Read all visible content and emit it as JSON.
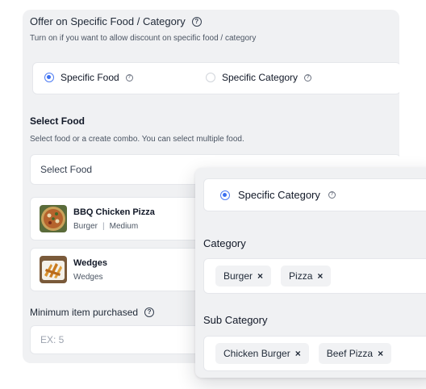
{
  "offer": {
    "title": "Offer on Specific Food / Category",
    "help_icon": "?",
    "description": "Turn on if you want to allow discount on specific food / category",
    "options": [
      {
        "label": "Specific Food",
        "selected": true
      },
      {
        "label": "Specific Category",
        "selected": false
      }
    ]
  },
  "select_food": {
    "title": "Select Food",
    "description": "Select food or a create combo. You can select multiple food.",
    "placeholder": "Select Food",
    "items": [
      {
        "name": "BBQ Chicken Pizza",
        "category": "Burger",
        "size": "Medium",
        "separator": "|",
        "thumb": "pizza-image"
      },
      {
        "name": "Wedges",
        "category": "Wedges",
        "thumb": "wedges-image"
      }
    ]
  },
  "minimum": {
    "label": "Minimum item purchased",
    "placeholder": "EX: 5"
  },
  "category_panel": {
    "option_label": "Specific Category",
    "category_title": "Category",
    "categories": [
      "Burger",
      "Pizza"
    ],
    "subcategory_title": "Sub Category",
    "subcategories": [
      "Chicken Burger",
      "Beef Pizza"
    ],
    "remove_glyph": "×"
  },
  "colors": {
    "accent": "#3b6ff0",
    "panel": "#f0f1f3"
  }
}
